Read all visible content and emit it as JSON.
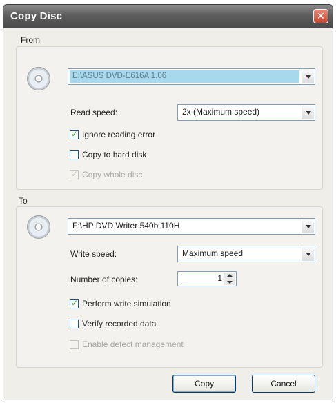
{
  "window": {
    "title": "Copy Disc",
    "close_glyph": "✕"
  },
  "from": {
    "group_label": "From",
    "drive": "E:\\ASUS DVD-E616A 1.06",
    "read_speed_label": "Read speed:",
    "read_speed_value": "2x (Maximum speed)",
    "options": [
      {
        "label": "Ignore reading error",
        "checked": true,
        "enabled": true
      },
      {
        "label": "Copy to hard disk",
        "checked": false,
        "enabled": true
      },
      {
        "label": "Copy whole disc",
        "checked": true,
        "enabled": false
      }
    ]
  },
  "to": {
    "group_label": "To",
    "drive": "F:\\HP DVD Writer 540b 110H",
    "write_speed_label": "Write speed:",
    "write_speed_value": "Maximum speed",
    "copies_label": "Number of copies:",
    "copies_value": "1",
    "options": [
      {
        "label": "Perform write simulation",
        "checked": true,
        "enabled": true
      },
      {
        "label": "Verify recorded data",
        "checked": false,
        "enabled": true
      },
      {
        "label": "Enable defect management",
        "checked": false,
        "enabled": false
      }
    ]
  },
  "buttons": {
    "copy": "Copy",
    "cancel": "Cancel"
  },
  "icons": {
    "from_drive": "disc-icon",
    "to_drive": "disc-icon",
    "checkmark": "✓"
  },
  "colors": {
    "titlebar": "#5d5d5d",
    "close": "#c8442c",
    "selection": "#a8d8ec",
    "check": "#21a121"
  }
}
